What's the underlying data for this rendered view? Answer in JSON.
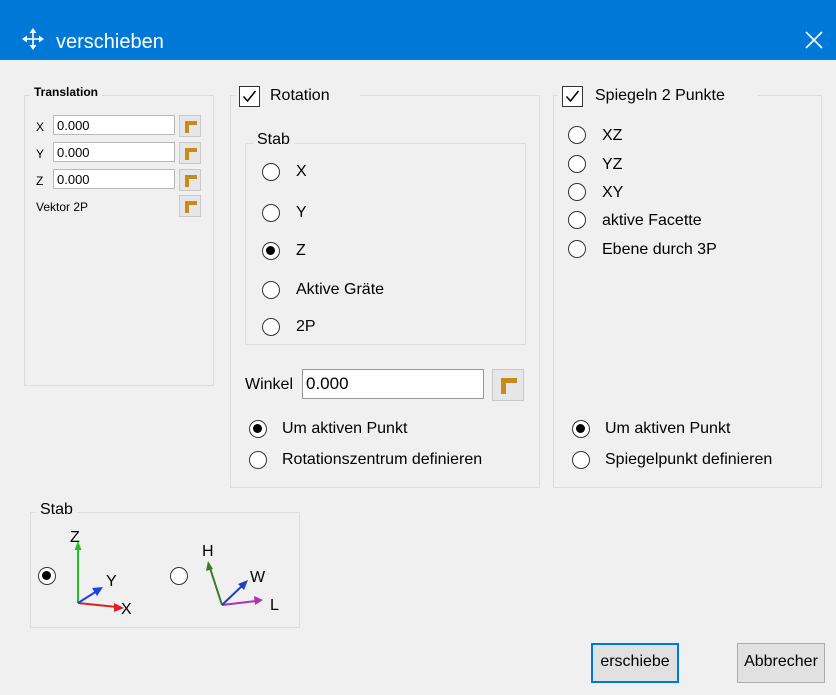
{
  "window": {
    "title": "verschieben",
    "title_icon": "move-arrows-icon",
    "close_icon": "close-icon",
    "accent_color": "#0078d7"
  },
  "translation": {
    "legend": "Translation",
    "x_label": "X",
    "x_value": "0.000",
    "y_label": "Y",
    "y_value": "0.000",
    "z_label": "Z",
    "z_value": "0.000",
    "vektor_label": "Vektor 2P",
    "pick_icon": "pick-point-icon"
  },
  "rotation": {
    "label": "Rotation",
    "checked": true,
    "stab_legend": "Stab",
    "options": [
      "X",
      "Y",
      "Z",
      "Aktive Gräte",
      "2P"
    ],
    "selected_option": "Z",
    "winkel_label": "Winkel",
    "winkel_value": "0.000",
    "center_options": [
      "Um aktiven Punkt",
      "Rotationszentrum definieren"
    ],
    "selected_center": "Um aktiven Punkt"
  },
  "spiegeln": {
    "label": "Spiegeln 2 Punkte",
    "checked": true,
    "options": [
      "XZ",
      "YZ",
      "XY",
      "aktive Facette",
      "Ebene durch 3P"
    ],
    "point_options": [
      "Um aktiven Punkt",
      "Spiegelpunkt definieren"
    ],
    "selected_point": "Um aktiven Punkt"
  },
  "stab_frame": {
    "legend": "Stab",
    "axes_xyz": {
      "x": "X",
      "y": "Y",
      "z": "Z"
    },
    "axes_hwl": {
      "h": "H",
      "w": "W",
      "l": "L"
    },
    "selected": "xyz"
  },
  "buttons": {
    "ok": "erschiebe",
    "cancel": "Abbrecher"
  }
}
